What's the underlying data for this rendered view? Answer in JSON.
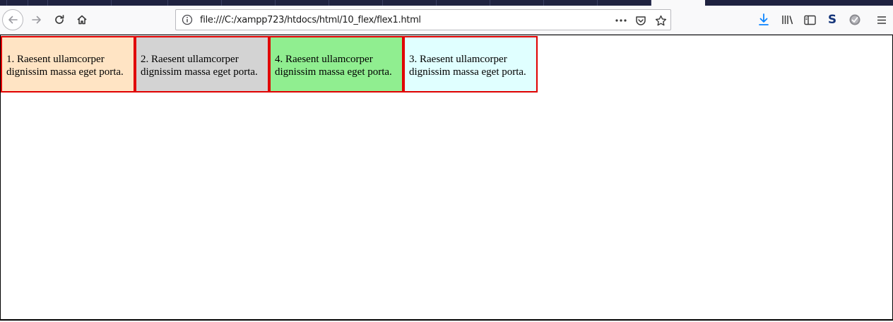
{
  "browser": {
    "url": "file:///C:/xampp723/htdocs/html/10_flex/flex1.html",
    "icons": {
      "back": "back-arrow-icon",
      "forward": "forward-arrow-icon",
      "reload": "reload-icon",
      "home": "home-icon",
      "info": "info-icon",
      "page_actions": "more-dots-icon",
      "pocket": "pocket-icon",
      "bookmark": "star-icon",
      "downloads": "download-icon",
      "library": "library-icon",
      "sidebar": "sidebar-icon",
      "extension_s": "s-extension-icon",
      "extension_check": "check-extension-icon",
      "menu": "hamburger-menu-icon"
    },
    "extension_s_label": "S",
    "accent_color": "#0a84ff"
  },
  "page": {
    "items": [
      {
        "text": "1. Raesent ullamcorper dignissim massa eget porta.",
        "background": "#ffe4c4"
      },
      {
        "text": "2. Raesent ullamcorper dignissim massa eget porta.",
        "background": "#d3d3d3"
      },
      {
        "text": "4. Raesent ullamcorper dignissim massa eget porta.",
        "background": "#90ee90"
      },
      {
        "text": "3. Raesent ullamcorper dignissim massa eget porta.",
        "background": "#e0ffff"
      }
    ],
    "border_color": "#e00000"
  }
}
